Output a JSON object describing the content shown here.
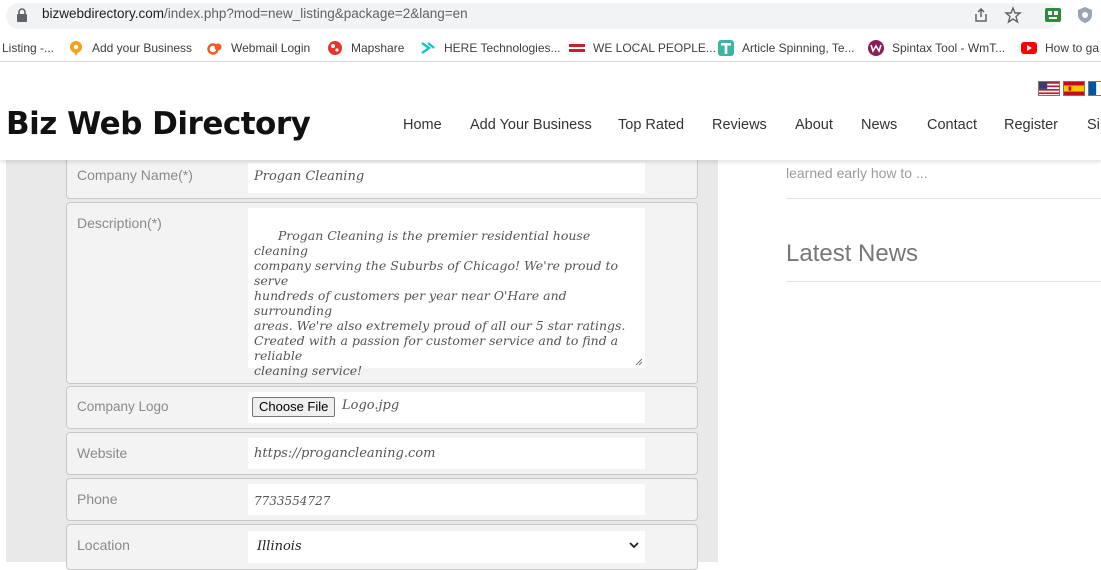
{
  "browser": {
    "url_host": "bizwebdirectory.com",
    "url_path": "/index.php?mod=new_listing&package=2&lang=en"
  },
  "bookmarks": [
    {
      "label": "Listing -...",
      "icon": "none",
      "color": ""
    },
    {
      "label": "Add your Business",
      "icon": "location-pin-icon",
      "color": "#f4a21b"
    },
    {
      "label": "Webmail Login",
      "icon": "cpanel-icon",
      "color": "#f05a24"
    },
    {
      "label": "Mapshare",
      "icon": "mapshare-icon",
      "color": "#e8332a"
    },
    {
      "label": "HERE Technologies...",
      "icon": "here-icon",
      "color": "#18c3c8"
    },
    {
      "label": "WE LOCAL PEOPLE...",
      "icon": "flag-icon",
      "color": "#c8202a"
    },
    {
      "label": "Article Spinning, Te...",
      "icon": "t-icon",
      "color": "#3cb5a5"
    },
    {
      "label": "Spintax Tool - WmT...",
      "icon": "wmt-icon",
      "color": "#8b1e5a"
    },
    {
      "label": "How to ga",
      "icon": "youtube-icon",
      "color": "#ff0000"
    }
  ],
  "site": {
    "logo": "Biz Web Directory",
    "nav": [
      "Home",
      "Add Your Business",
      "Top Rated",
      "Reviews",
      "About",
      "News",
      "Contact",
      "Register",
      "Si"
    ]
  },
  "form": {
    "company_name_label": "Company Name(*)",
    "company_name_value": "Progan Cleaning",
    "description_label": "Description(*)",
    "description_value": "Progan Cleaning is the premier residential house cleaning\ncompany serving the Suburbs of Chicago! We're proud to serve\nhundreds of customers per year near O'Hare and surrounding\nareas. We're also extremely proud of all our 5 star ratings.\nCreated with a passion for customer service and to find a reliable\ncleaning service!",
    "logo_label": "Company Logo",
    "choose_file_label": "Choose File",
    "logo_file": "Logo.jpg",
    "website_label": "Website",
    "website_value": "https://progancleaning.com",
    "phone_label": "Phone",
    "phone_value": "7733554727",
    "location_label": "Location",
    "location_value": "Illinois"
  },
  "sidebar": {
    "snippet": "learned early how to ...",
    "latest_news_title": "Latest News"
  }
}
